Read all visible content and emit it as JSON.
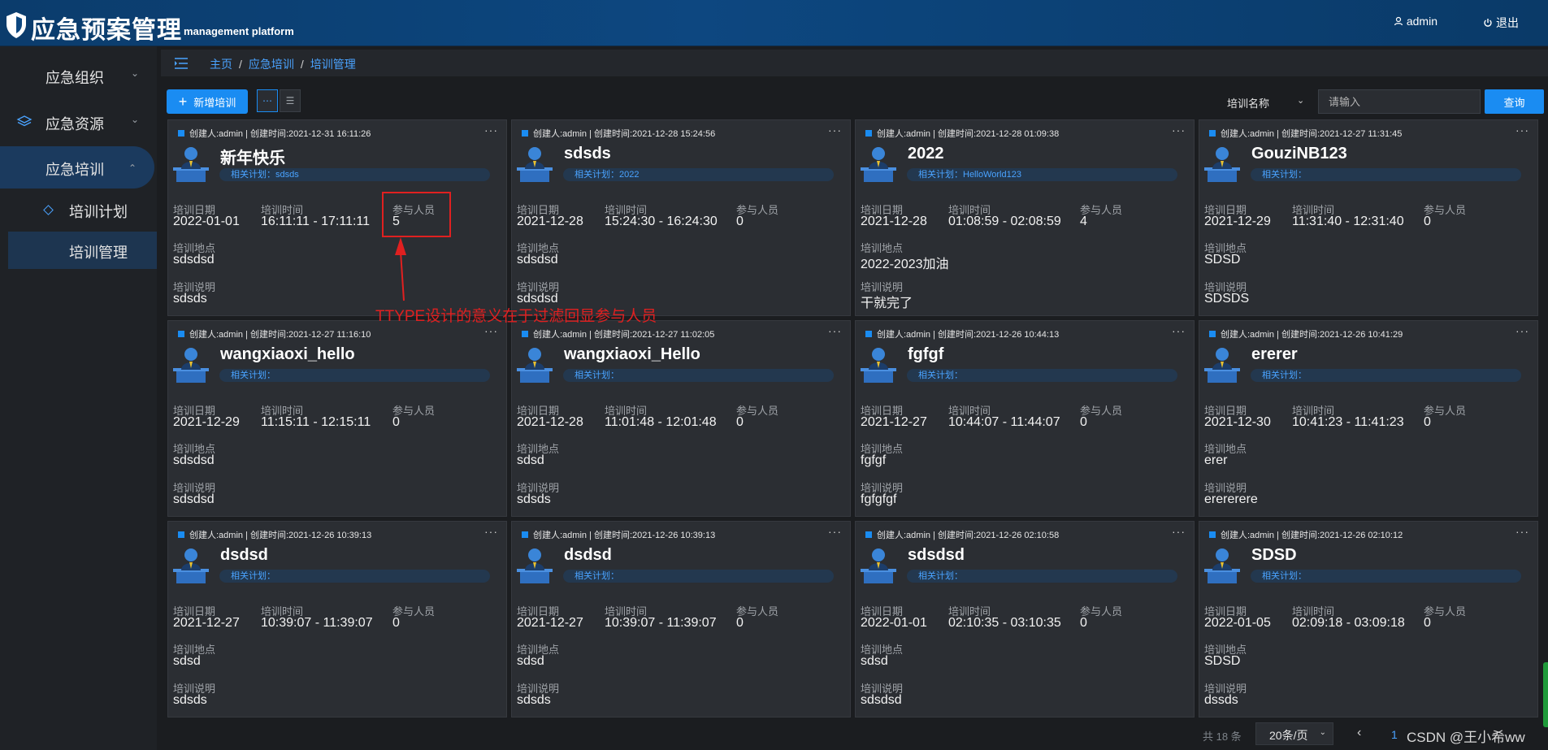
{
  "header": {
    "title": "应急预案管理",
    "subtitle": "management platform",
    "user": "admin",
    "logout": "退出"
  },
  "sidebar": {
    "items": [
      {
        "label": "应急组织"
      },
      {
        "label": "应急资源"
      },
      {
        "label": "应急培训"
      }
    ],
    "sub_items": [
      {
        "label": "培训计划"
      },
      {
        "label": "培训管理"
      }
    ]
  },
  "breadcrumb": [
    "主页",
    "应急培训",
    "培训管理"
  ],
  "toolbar": {
    "add_label": "新增培训",
    "filter_field": "培训名称",
    "search_placeholder": "请输入",
    "query_label": "查询"
  },
  "card_labels": {
    "date": "培训日期",
    "time": "培训时间",
    "people": "参与人员",
    "place": "培训地点",
    "desc": "培训说明"
  },
  "cards": [
    {
      "meta": "创建人:admin | 创建时间:2021-12-31 16:11:26",
      "title": "新年快乐",
      "plan": "相关计划：sdsds",
      "date": "2022-01-01",
      "time": "16:11:11 - 17:11:11",
      "people": "5",
      "place": "sdsdsd",
      "desc": "sdsds"
    },
    {
      "meta": "创建人:admin | 创建时间:2021-12-28 15:24:56",
      "title": "sdsds",
      "plan": "相关计划：2022",
      "date": "2021-12-28",
      "time": "15:24:30 - 16:24:30",
      "people": "0",
      "place": "sdsdsd",
      "desc": "sdsdsd"
    },
    {
      "meta": "创建人:admin | 创建时间:2021-12-28 01:09:38",
      "title": "2022",
      "plan": "相关计划：HelloWorld123",
      "date": "2021-12-28",
      "time": "01:08:59 - 02:08:59",
      "people": "4",
      "place": "2022-2023加油",
      "desc": "干就完了"
    },
    {
      "meta": "创建人:admin | 创建时间:2021-12-27 11:31:45",
      "title": "GouziNB123",
      "plan": "相关计划：",
      "date": "2021-12-29",
      "time": "11:31:40 - 12:31:40",
      "people": "0",
      "place": "SDSD",
      "desc": "SDSDS"
    },
    {
      "meta": "创建人:admin | 创建时间:2021-12-27 11:16:10",
      "title": "wangxiaoxi_hello",
      "plan": "相关计划：",
      "date": "2021-12-29",
      "time": "11:15:11 - 12:15:11",
      "people": "0",
      "place": "sdsdsd",
      "desc": "sdsdsd"
    },
    {
      "meta": "创建人:admin | 创建时间:2021-12-27 11:02:05",
      "title": "wangxiaoxi_Hello",
      "plan": "相关计划：",
      "date": "2021-12-28",
      "time": "11:01:48 - 12:01:48",
      "people": "0",
      "place": "sdsd",
      "desc": "sdsds"
    },
    {
      "meta": "创建人:admin | 创建时间:2021-12-26 10:44:13",
      "title": "fgfgf",
      "plan": "相关计划：",
      "date": "2021-12-27",
      "time": "10:44:07 - 11:44:07",
      "people": "0",
      "place": "fgfgf",
      "desc": "fgfgfgf"
    },
    {
      "meta": "创建人:admin | 创建时间:2021-12-26 10:41:29",
      "title": "ererer",
      "plan": "相关计划：",
      "date": "2021-12-30",
      "time": "10:41:23 - 11:41:23",
      "people": "0",
      "place": "erer",
      "desc": "erererere"
    },
    {
      "meta": "创建人:admin | 创建时间:2021-12-26 10:39:13",
      "title": "dsdsd",
      "plan": "相关计划：",
      "date": "2021-12-27",
      "time": "10:39:07 - 11:39:07",
      "people": "0",
      "place": "sdsd",
      "desc": "sdsds"
    },
    {
      "meta": "创建人:admin | 创建时间:2021-12-26 10:39:13",
      "title": "dsdsd",
      "plan": "相关计划：",
      "date": "2021-12-27",
      "time": "10:39:07 - 11:39:07",
      "people": "0",
      "place": "sdsd",
      "desc": "sdsds"
    },
    {
      "meta": "创建人:admin | 创建时间:2021-12-26 02:10:58",
      "title": "sdsdsd",
      "plan": "相关计划：",
      "date": "2022-01-01",
      "time": "02:10:35 - 03:10:35",
      "people": "0",
      "place": "sdsd",
      "desc": "sdsdsd"
    },
    {
      "meta": "创建人:admin | 创建时间:2021-12-26 02:10:12",
      "title": "SDSD",
      "plan": "相关计划：",
      "date": "2022-01-05",
      "time": "02:09:18 - 03:09:18",
      "people": "0",
      "place": "SDSD",
      "desc": "dssds"
    }
  ],
  "annotation": "TTYPE设计的意义在于过滤回显参与人员",
  "pagination": {
    "total": "共 18 条",
    "page_size": "20条/页",
    "current_page": "1"
  },
  "watermark": "CSDN @王小希ww",
  "colors": {
    "accent": "#1a8cf2",
    "header": "#0d4780",
    "annotation": "#e02020"
  }
}
